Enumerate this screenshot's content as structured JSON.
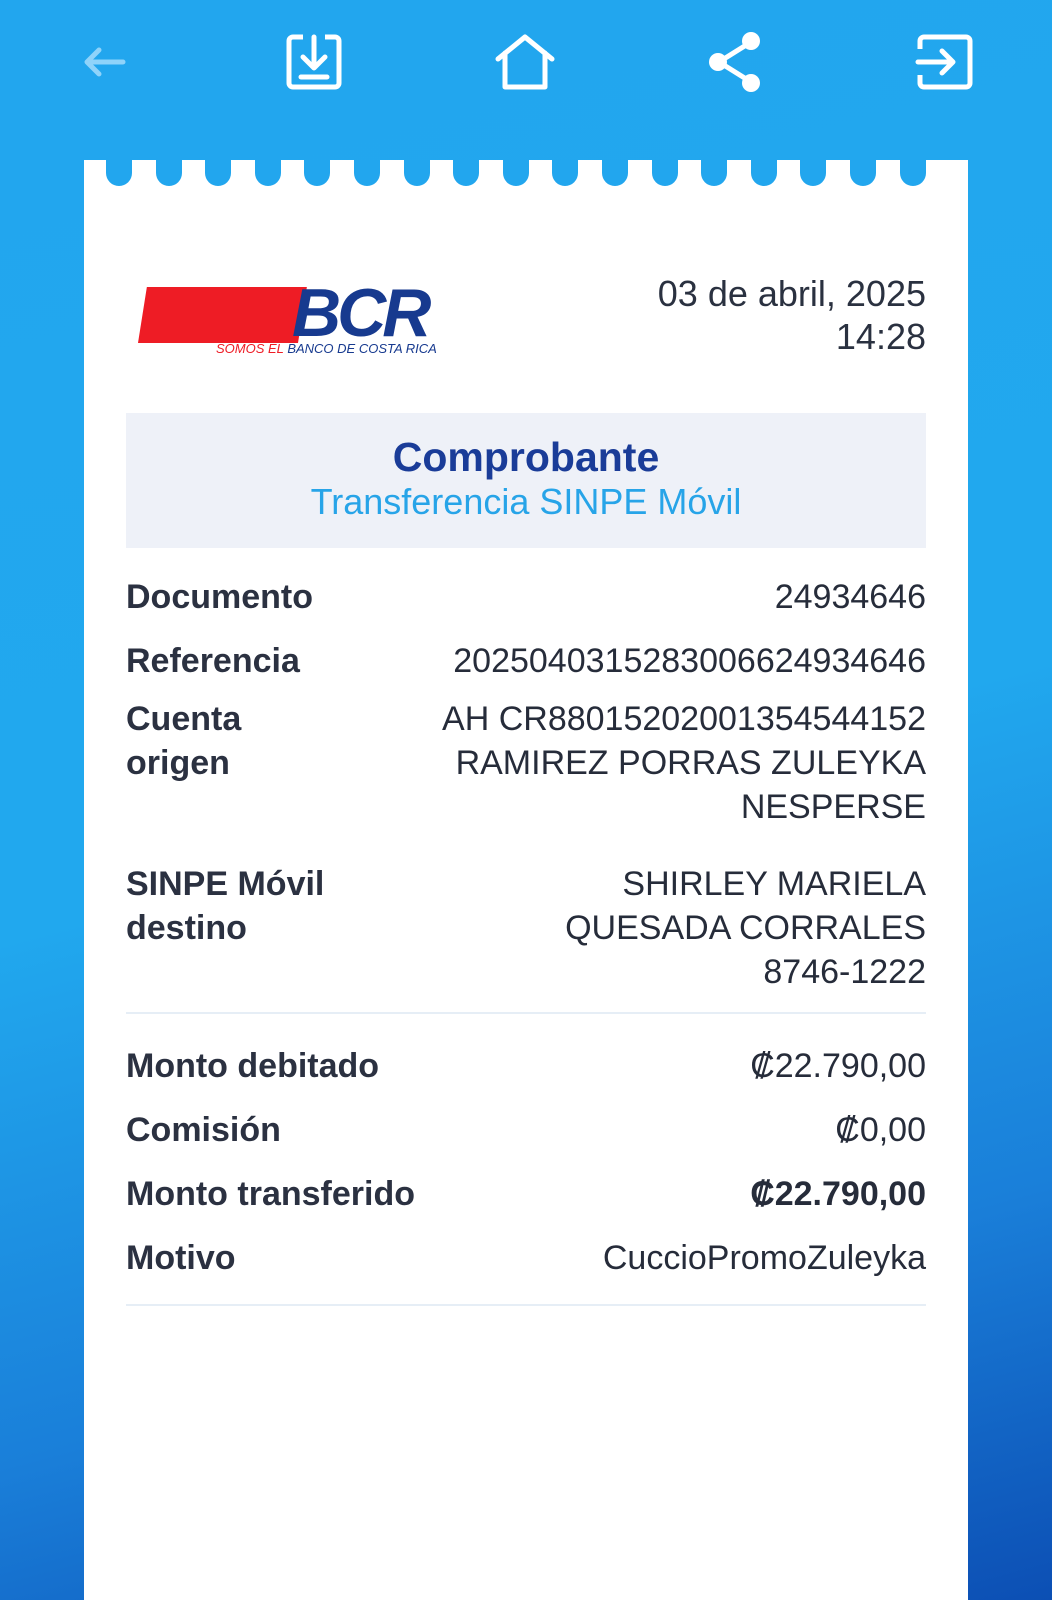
{
  "toolbar": {
    "icons": [
      "back-arrow-icon",
      "download-icon",
      "home-icon",
      "share-icon",
      "logout-icon"
    ]
  },
  "logo": {
    "wordmark": "BCR",
    "tagline_part1": "SOMOS EL",
    "tagline_part2": "BANCO DE COSTA RICA"
  },
  "header": {
    "date": "03 de abril, 2025",
    "time": "14:28"
  },
  "title": {
    "main": "Comprobante",
    "sub": "Transferencia SINPE Móvil"
  },
  "details": {
    "documento": {
      "label": "Documento",
      "value": "24934646"
    },
    "referencia": {
      "label": "Referencia",
      "value": "2025040315283006624934646"
    },
    "cuenta_origen": {
      "label_line1": "Cuenta",
      "label_line2": "origen",
      "value_line1": "AH CR88015202001354544152",
      "value_line2": "RAMIREZ PORRAS ZULEYKA",
      "value_line3": "NESPERSE"
    },
    "sinpe_destino": {
      "label_line1": "SINPE Móvil",
      "label_line2": "destino",
      "value_line1": "SHIRLEY MARIELA",
      "value_line2": "QUESADA CORRALES",
      "value_line3": "8746-1222"
    }
  },
  "amounts": {
    "monto_debitado": {
      "label": "Monto debitado",
      "value": "₡22.790,00"
    },
    "comision": {
      "label": "Comisión",
      "value": "₡0,00"
    },
    "monto_transferido": {
      "label": "Monto transferido",
      "value": "₡22.790,00"
    },
    "motivo": {
      "label": "Motivo",
      "value": "CuccioPromoZuleyka"
    }
  },
  "colors": {
    "background": "#22a6ee",
    "brand_blue": "#173a8f",
    "brand_red": "#ee1c25",
    "title_blue": "#1a3c98",
    "subtitle_blue": "#27a4e8"
  }
}
